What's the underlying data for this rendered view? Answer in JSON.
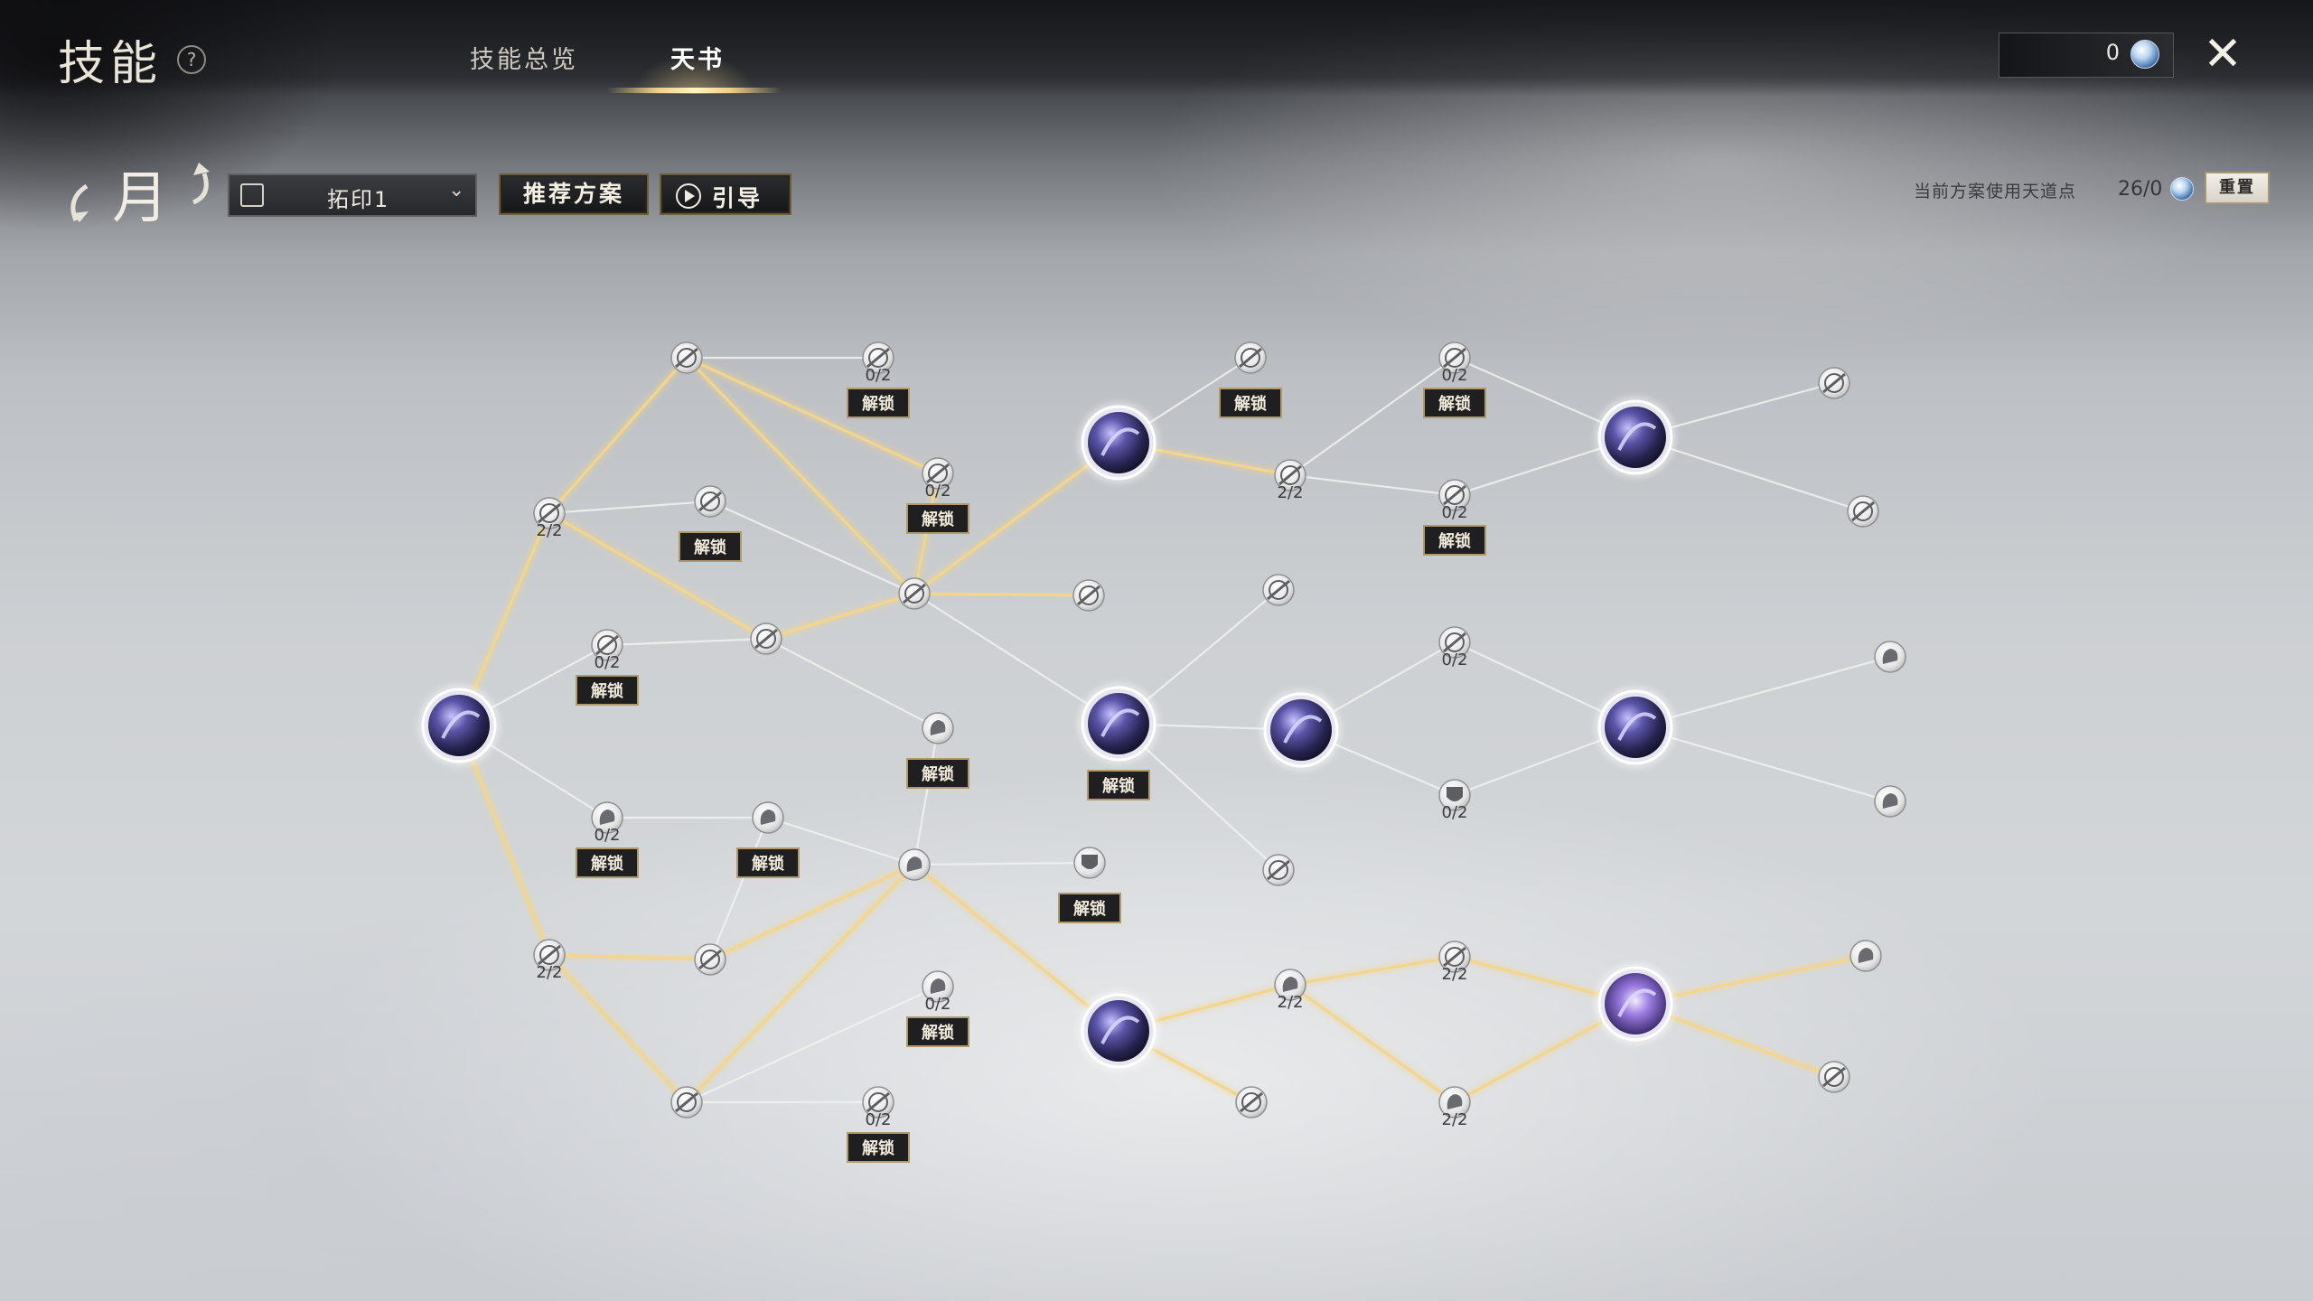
{
  "header": {
    "title": "技能",
    "tabs": [
      {
        "label": "技能总览",
        "active": false
      },
      {
        "label": "天书",
        "active": true
      }
    ],
    "currency_value": "0",
    "close_icon": "close-x-icon"
  },
  "toolbar": {
    "moon_label": "月",
    "preset_value": "拓印1",
    "recommend_label": "推荐方案",
    "guide_label": "引导",
    "points_label": "当前方案使用天道点",
    "points_value": "26/0",
    "reset_label": "重置"
  },
  "colors": {
    "active_path": "#f3d58c",
    "inactive_path": "#f2f2f0",
    "core_node": "#3c3a78",
    "badge_bg": "#1f1f21",
    "badge_border": "#b09a6a"
  },
  "skill_tree": {
    "unlock_label": "解锁",
    "nodes": [
      {
        "id": "root",
        "type": "core",
        "icon": "crescent-slash-icon"
      },
      {
        "id": "a1",
        "type": "minor",
        "icon": "blade-icon",
        "count": "2/2"
      },
      {
        "id": "a2",
        "type": "minor",
        "icon": "blade-icon"
      },
      {
        "id": "a3",
        "type": "minor",
        "icon": "blade-icon",
        "count": "0/2",
        "unlock": true
      },
      {
        "id": "a4",
        "type": "minor",
        "icon": "blade-icon",
        "unlock": true
      },
      {
        "id": "a5",
        "type": "minor",
        "icon": "blade-icon",
        "count": "0/2",
        "unlock": true
      },
      {
        "id": "a6",
        "type": "minor",
        "icon": "blade-icon",
        "count": "0/2",
        "unlock": true
      },
      {
        "id": "a7",
        "type": "minor",
        "icon": "blade-icon"
      },
      {
        "id": "a8",
        "type": "minor",
        "icon": "blade-icon"
      },
      {
        "id": "a9",
        "type": "minor",
        "icon": "blade-icon"
      },
      {
        "id": "b1",
        "type": "core",
        "icon": "wind-slash-icon"
      },
      {
        "id": "b2",
        "type": "minor",
        "icon": "blade-icon",
        "unlock": true
      },
      {
        "id": "b3",
        "type": "minor",
        "icon": "blade-icon",
        "count": "2/2"
      },
      {
        "id": "b4",
        "type": "minor",
        "icon": "blade-icon",
        "count": "0/2",
        "unlock": true
      },
      {
        "id": "b5",
        "type": "minor",
        "icon": "blade-icon",
        "count": "0/2",
        "unlock": true
      },
      {
        "id": "b6",
        "type": "core",
        "icon": "swirl-orb-icon"
      },
      {
        "id": "b7",
        "type": "minor",
        "icon": "blade-icon"
      },
      {
        "id": "b8",
        "type": "minor",
        "icon": "blade-icon"
      },
      {
        "id": "c1",
        "type": "minor",
        "icon": "claw-icon",
        "unlock": true
      },
      {
        "id": "c2",
        "type": "core",
        "icon": "cross-slash-icon",
        "unlock": true
      },
      {
        "id": "c3",
        "type": "minor",
        "icon": "blade-icon"
      },
      {
        "id": "c4",
        "type": "core",
        "icon": "dark-moon-icon"
      },
      {
        "id": "c5",
        "type": "minor",
        "icon": "blade-icon",
        "count": "0/2"
      },
      {
        "id": "c6",
        "type": "minor",
        "icon": "shield-icon",
        "count": "0/2"
      },
      {
        "id": "c7",
        "type": "core",
        "icon": "spiral-orb-icon"
      },
      {
        "id": "c8",
        "type": "minor",
        "icon": "hand-icon"
      },
      {
        "id": "c9",
        "type": "minor",
        "icon": "hand-icon"
      },
      {
        "id": "d1",
        "type": "minor",
        "icon": "fist-icon",
        "count": "0/2",
        "unlock": true
      },
      {
        "id": "d2",
        "type": "minor",
        "icon": "heart-hand-icon",
        "unlock": true
      },
      {
        "id": "d3",
        "type": "minor",
        "icon": "fist-icon"
      },
      {
        "id": "d4",
        "type": "minor",
        "icon": "shield-icon",
        "unlock": true
      },
      {
        "id": "d5",
        "type": "minor",
        "icon": "blade-icon"
      },
      {
        "id": "e1",
        "type": "minor",
        "icon": "blade-icon",
        "count": "2/2"
      },
      {
        "id": "e2",
        "type": "minor",
        "icon": "blade-icon"
      },
      {
        "id": "e3",
        "type": "minor",
        "icon": "blade-icon"
      },
      {
        "id": "e4",
        "type": "minor",
        "icon": "blade-icon",
        "count": "0/2",
        "unlock": true
      },
      {
        "id": "e5",
        "type": "minor",
        "icon": "fist-icon",
        "count": "0/2",
        "unlock": true
      },
      {
        "id": "e6",
        "type": "core",
        "icon": "beast-claw-icon"
      },
      {
        "id": "e7",
        "type": "minor",
        "icon": "blade-icon"
      },
      {
        "id": "e8",
        "type": "minor",
        "icon": "fist-icon",
        "count": "2/2"
      },
      {
        "id": "e9",
        "type": "minor",
        "icon": "blade-icon",
        "count": "2/2"
      },
      {
        "id": "e10",
        "type": "minor",
        "icon": "fist-icon",
        "count": "2/2"
      },
      {
        "id": "e11",
        "type": "core",
        "icon": "glowing-orb-icon"
      },
      {
        "id": "e12",
        "type": "minor",
        "icon": "fist-icon"
      },
      {
        "id": "e13",
        "type": "minor",
        "icon": "blade-icon"
      }
    ],
    "links": [
      [
        "root",
        "a1",
        true
      ],
      [
        "a1",
        "a2",
        true
      ],
      [
        "a2",
        "a3",
        false
      ],
      [
        "a2",
        "a5",
        true
      ],
      [
        "a1",
        "a4",
        false
      ],
      [
        "a4",
        "a8",
        false
      ],
      [
        "a1",
        "a7",
        true
      ],
      [
        "a5",
        "a8",
        true
      ],
      [
        "a2",
        "a8",
        true
      ],
      [
        "a8",
        "b1",
        true
      ],
      [
        "a8",
        "a9",
        true
      ],
      [
        "a7",
        "a8",
        true
      ],
      [
        "root",
        "a6",
        false
      ],
      [
        "a6",
        "a7",
        false
      ],
      [
        "a7",
        "c1",
        false
      ],
      [
        "a8",
        "c2",
        false
      ],
      [
        "b1",
        "b2",
        false
      ],
      [
        "b1",
        "b3",
        true
      ],
      [
        "b3",
        "b4",
        false
      ],
      [
        "b4",
        "b6",
        false
      ],
      [
        "b3",
        "b5",
        false
      ],
      [
        "b5",
        "b6",
        false
      ],
      [
        "b6",
        "b7",
        false
      ],
      [
        "b6",
        "b8",
        false
      ],
      [
        "c2",
        "c3",
        false
      ],
      [
        "c2",
        "c4",
        false
      ],
      [
        "c4",
        "c5",
        false
      ],
      [
        "c4",
        "c6",
        false
      ],
      [
        "c6",
        "c7",
        false
      ],
      [
        "c5",
        "c7",
        false
      ],
      [
        "c7",
        "c8",
        false
      ],
      [
        "c7",
        "c9",
        false
      ],
      [
        "c2",
        "d5",
        false
      ],
      [
        "root",
        "d1",
        false
      ],
      [
        "d1",
        "d2",
        false
      ],
      [
        "d2",
        "d3",
        false
      ],
      [
        "c1",
        "d3",
        false
      ],
      [
        "d3",
        "d4",
        false
      ],
      [
        "root",
        "e1",
        true
      ],
      [
        "e1",
        "e2",
        true
      ],
      [
        "e1",
        "e3",
        true
      ],
      [
        "e2",
        "d3",
        true
      ],
      [
        "e3",
        "d3",
        true
      ],
      [
        "e3",
        "e4",
        false
      ],
      [
        "e3",
        "e5",
        false
      ],
      [
        "d2",
        "e2",
        false
      ],
      [
        "d3",
        "e6",
        true
      ],
      [
        "e6",
        "e7",
        true
      ],
      [
        "e6",
        "e8",
        true
      ],
      [
        "e8",
        "e9",
        true
      ],
      [
        "e8",
        "e10",
        true
      ],
      [
        "e9",
        "e11",
        true
      ],
      [
        "e10",
        "e11",
        true
      ],
      [
        "e11",
        "e12",
        true
      ],
      [
        "e11",
        "e13",
        true
      ]
    ]
  }
}
